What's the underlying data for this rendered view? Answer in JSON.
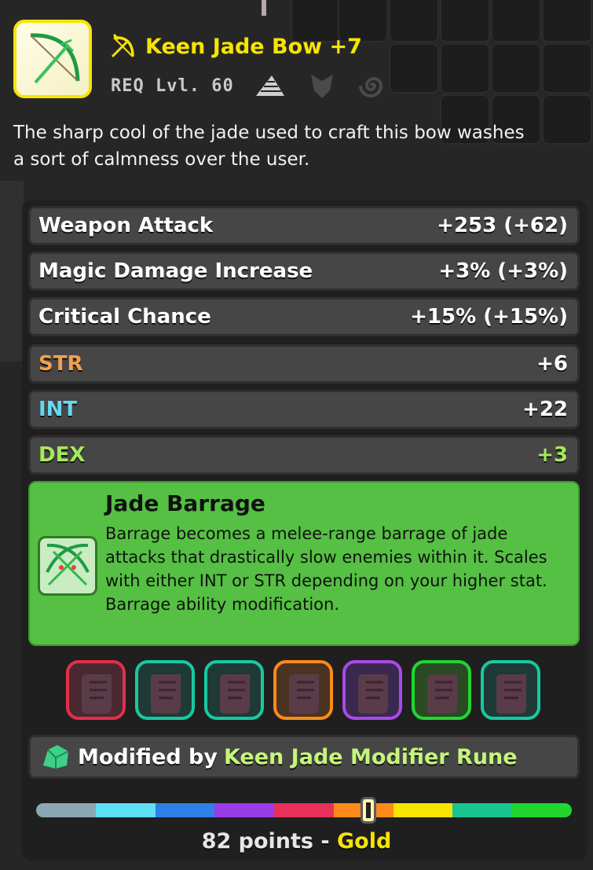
{
  "item": {
    "name": "Keen Jade Bow +7",
    "type_icon": "bow-icon",
    "icon": "jade-bow-icon",
    "requirement": "REQ Lvl. 60",
    "req_icons": [
      "ranger-class-icon",
      "armor-class-icon",
      "spiral-class-icon"
    ],
    "description": "The sharp cool of the jade used to craft this bow washes\na sort of calmness over the user.",
    "rarity_color": "#f7e400"
  },
  "stats": [
    {
      "label": "Weapon Attack",
      "value": "+253 (+62)",
      "color": "#ffffff"
    },
    {
      "label": "Magic Damage Increase",
      "value": "+3% (+3%)",
      "color": "#ffffff"
    },
    {
      "label": "Critical Chance",
      "value": "+15% (+15%)",
      "color": "#ffffff"
    },
    {
      "label": "STR",
      "value": "+6",
      "color": "#f0a050",
      "value_color": "#ffffff"
    },
    {
      "label": "INT",
      "value": "+22",
      "color": "#66d8f0",
      "value_color": "#ffffff"
    },
    {
      "label": "DEX",
      "value": "+3",
      "color": "#a6e85a",
      "value_color": "#a6e85a"
    }
  ],
  "ability": {
    "title": "Jade Barrage",
    "description": "Barrage becomes a melee-range barrage of jade attacks that drastically slow enemies within it. Scales with either INT or STR depending on your higher stat. Barrage ability modification.",
    "icon": "crossed-bows-icon"
  },
  "runes": [
    {
      "icon": "scroll-icon",
      "border": "#e0304a"
    },
    {
      "icon": "scroll-icon",
      "border": "#18c9a0"
    },
    {
      "icon": "scroll-icon",
      "border": "#18c9a0"
    },
    {
      "icon": "scroll-icon",
      "border": "#ff8a1a"
    },
    {
      "icon": "scroll-icon",
      "border": "#a74be8"
    },
    {
      "icon": "scroll-icon",
      "border": "#22d630"
    },
    {
      "icon": "scroll-icon",
      "border": "#18c9a0"
    }
  ],
  "modifier": {
    "prefix": "Modified by",
    "name": "Keen Jade Modifier Rune",
    "icon": "jade-gem-icon"
  },
  "quality": {
    "points_text": "82 points",
    "dash": " - ",
    "tier": "Gold",
    "fraction": 0.62,
    "segments": [
      "#8aa8b4",
      "#5ee0f5",
      "#2f7fe8",
      "#9a3be8",
      "#e8305a",
      "#ff8a1a",
      "#f7e400",
      "#18c490",
      "#22d630"
    ]
  }
}
